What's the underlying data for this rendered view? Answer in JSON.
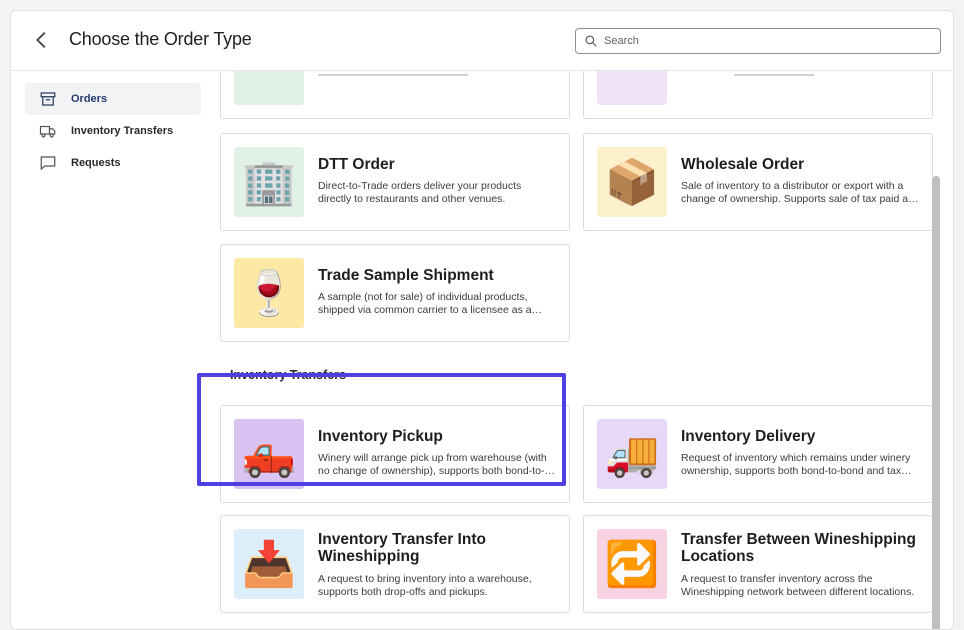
{
  "header": {
    "back_label": "Back",
    "title": "Choose the Order Type",
    "search_placeholder": "Search"
  },
  "sidebar": {
    "items": [
      {
        "label": "Orders",
        "icon": "archive-box-icon",
        "active": true
      },
      {
        "label": "Inventory Transfers",
        "icon": "truck-icon",
        "active": false
      },
      {
        "label": "Requests",
        "icon": "chat-bubble-icon",
        "active": false
      }
    ]
  },
  "orders": {
    "cards": [
      {
        "title": "DTT Order",
        "description": "Direct-to-Trade orders deliver your products directly to restaurants and other venues.",
        "icon": "office-building-icon",
        "glyph": "🏢"
      },
      {
        "title": "Wholesale Order",
        "description": "Sale of inventory to a distributor or export with a change of ownership. Supports sale of tax paid and in-bond inventory.",
        "icon": "boxes-icon",
        "glyph": "📦"
      },
      {
        "title": "Trade Sample Shipment",
        "description": "A sample (not for sale) of individual products, shipped via common carrier to a licensee as a trade sample.",
        "icon": "wine-glass-icon",
        "glyph": "🍷"
      }
    ]
  },
  "inventory_transfers": {
    "section_title": "Inventory Transfers",
    "cards": [
      {
        "title": "Inventory Pickup",
        "description": "Winery will arrange pick up from warehouse (with no change of ownership), supports both bond-to-bond and tax paid.",
        "icon": "pickup-truck-icon",
        "glyph": "🛻"
      },
      {
        "title": "Inventory Delivery",
        "description": "Request of inventory which remains under winery ownership, supports both bond-to-bond and tax paid.",
        "icon": "delivery-truck-icon",
        "glyph": "🚚"
      },
      {
        "title": "Inventory Transfer Into Wineshipping",
        "description": "A request to bring inventory into a warehouse, supports both drop-offs and pickups.",
        "icon": "inbox-tray-icon",
        "glyph": "📥"
      },
      {
        "title": "Transfer Between Wineshipping Locations",
        "description": "A request to transfer inventory across the Wineshipping network between different locations.",
        "icon": "repeat-arrows-icon",
        "glyph": "🔁"
      }
    ]
  },
  "colors": {
    "highlight": "#4f3fe0",
    "active_nav_text": "#233a6b",
    "active_nav_bg": "#f2f3f5"
  }
}
